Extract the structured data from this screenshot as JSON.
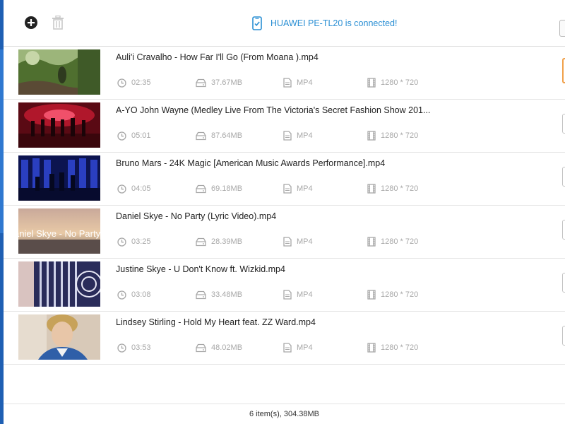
{
  "toolbar": {
    "add_icon": "plus-circle-icon",
    "delete_icon": "trash-icon"
  },
  "device": {
    "icon": "phone-check-icon",
    "status_text": "HUAWEI PE-TL20 is connected!"
  },
  "icons": {
    "duration": "clock-icon",
    "size": "hard-drive-icon",
    "format": "file-icon",
    "resolution": "film-icon"
  },
  "videos": [
    {
      "title": "Auli'i Cravalho - How Far I'll Go (From  Moana ).mp4",
      "duration": "02:35",
      "size": "37.67MB",
      "format": "MP4",
      "resolution": "1280 * 720"
    },
    {
      "title": "A-YO   John Wayne (Medley Live From The Victoria's Secret Fashion Show 201...",
      "duration": "05:01",
      "size": "87.64MB",
      "format": "MP4",
      "resolution": "1280 * 720"
    },
    {
      "title": "Bruno Mars - 24K Magic [American Music Awards Performance].mp4",
      "duration": "04:05",
      "size": "69.18MB",
      "format": "MP4",
      "resolution": "1280 * 720"
    },
    {
      "title": "Daniel Skye - No Party (Lyric Video).mp4",
      "duration": "03:25",
      "size": "28.39MB",
      "format": "MP4",
      "resolution": "1280 * 720",
      "thumb_text": "aniel Skye - No Party"
    },
    {
      "title": "Justine Skye - U Don't Know ft. Wizkid.mp4",
      "duration": "03:08",
      "size": "33.48MB",
      "format": "MP4",
      "resolution": "1280 * 720"
    },
    {
      "title": "Lindsey Stirling - Hold My Heart feat. ZZ Ward.mp4",
      "duration": "03:53",
      "size": "48.02MB",
      "format": "MP4",
      "resolution": "1280 * 720"
    }
  ],
  "status": {
    "summary": "6 item(s), 304.38MB"
  }
}
